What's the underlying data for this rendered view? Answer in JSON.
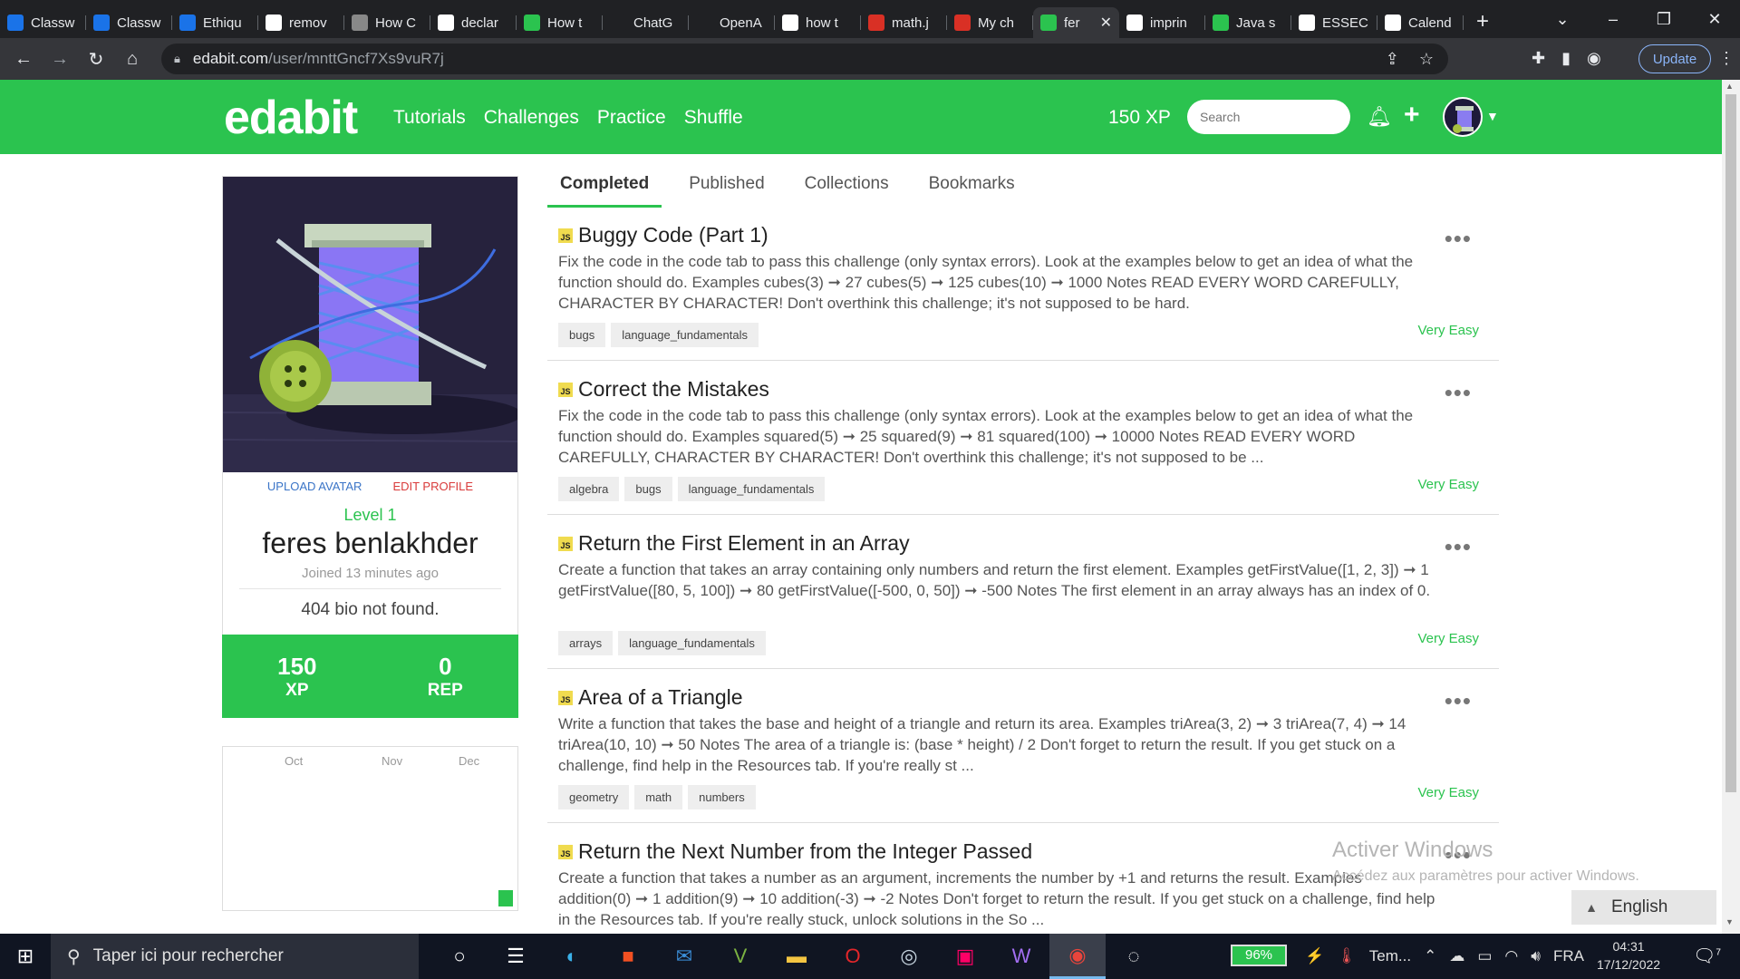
{
  "browser": {
    "tabs": [
      {
        "label": "Classw",
        "icon": "classroom-icon",
        "color": "#1a73e8"
      },
      {
        "label": "Classw",
        "icon": "classroom-icon",
        "color": "#1a73e8"
      },
      {
        "label": "Ethiqu",
        "icon": "classroom-icon",
        "color": "#1a73e8"
      },
      {
        "label": "remov",
        "icon": "google-icon",
        "color": "#ffffff"
      },
      {
        "label": "How C",
        "icon": "triangle-icon",
        "color": "#888888"
      },
      {
        "label": "declar",
        "icon": "google-icon",
        "color": "#ffffff"
      },
      {
        "label": "How t",
        "icon": "wave-icon",
        "color": "#2bc34f"
      },
      {
        "label": "ChatG",
        "icon": "chatgpt-icon",
        "color": "#202124"
      },
      {
        "label": "OpenA",
        "icon": "openai-icon",
        "color": "#202124"
      },
      {
        "label": "how t",
        "icon": "google-icon",
        "color": "#ffffff"
      },
      {
        "label": "math.j",
        "icon": "m-icon",
        "color": "#d93025"
      },
      {
        "label": "My ch",
        "icon": "opera-icon",
        "color": "#d93025"
      },
      {
        "label": "fer",
        "icon": "edabit-icon",
        "color": "#2bc34f",
        "active": true
      },
      {
        "label": "imprin",
        "icon": "google-icon",
        "color": "#ffffff"
      },
      {
        "label": "Java s",
        "icon": "w-icon",
        "color": "#2bc34f"
      },
      {
        "label": "ESSEC",
        "icon": "essec-icon",
        "color": "#ffffff"
      },
      {
        "label": "Calend",
        "icon": "calendar-icon",
        "color": "#ffffff"
      }
    ],
    "url_host": "edabit.com",
    "url_path": "/user/mnttGncf7Xs9vuR7j",
    "update_label": "Update"
  },
  "site": {
    "logo": "edabit",
    "nav": [
      "Tutorials",
      "Challenges",
      "Practice",
      "Shuffle"
    ],
    "xp": "150 XP",
    "search_placeholder": "Search"
  },
  "profile": {
    "upload_avatar": "UPLOAD AVATAR",
    "edit_profile": "EDIT PROFILE",
    "level": "Level 1",
    "username": "feres benlakhder",
    "joined": "Joined 13 minutes ago",
    "bio": "404 bio not found.",
    "xp_value": "150",
    "xp_label": "XP",
    "rep_value": "0",
    "rep_label": "REP"
  },
  "heatmap": {
    "months": [
      "Oct",
      "Nov",
      "Dec"
    ]
  },
  "tabs": [
    "Completed",
    "Published",
    "Collections",
    "Bookmarks"
  ],
  "challenges": [
    {
      "lang": "JS",
      "title": "Buggy Code (Part 1)",
      "desc": "Fix the code in the code tab to pass this challenge (only syntax errors). Look at the examples below to get an idea of what the function should do. Examples cubes(3) ➞ 27 cubes(5) ➞ 125 cubes(10) ➞ 1000 Notes READ EVERY WORD CAREFULLY, CHARACTER BY CHARACTER! Don't overthink this challenge; it's not supposed to be hard.",
      "tags": [
        "bugs",
        "language_fundamentals"
      ],
      "difficulty": "Very Easy"
    },
    {
      "lang": "JS",
      "title": "Correct the Mistakes",
      "desc": "Fix the code in the code tab to pass this challenge (only syntax errors). Look at the examples below to get an idea of what the function should do. Examples squared(5) ➞ 25 squared(9) ➞ 81 squared(100) ➞ 10000 Notes READ EVERY WORD CAREFULLY, CHARACTER BY CHARACTER! Don't overthink this challenge; it's not supposed to be ...",
      "tags": [
        "algebra",
        "bugs",
        "language_fundamentals"
      ],
      "difficulty": "Very Easy"
    },
    {
      "lang": "JS",
      "title": "Return the First Element in an Array",
      "desc": "Create a function that takes an array containing only numbers and return the first element. Examples getFirstValue([1, 2, 3]) ➞ 1 getFirstValue([80, 5, 100]) ➞ 80 getFirstValue([-500, 0, 50]) ➞ -500 Notes The first element in an array always has an index of 0.",
      "tags": [
        "arrays",
        "language_fundamentals"
      ],
      "difficulty": "Very Easy"
    },
    {
      "lang": "JS",
      "title": "Area of a Triangle",
      "desc": "Write a function that takes the base and height of a triangle and return its area. Examples triArea(3, 2) ➞ 3 triArea(7, 4) ➞ 14 triArea(10, 10) ➞ 50 Notes The area of a triangle is: (base * height) / 2 Don't forget to return the result. If you get stuck on a challenge, find help in the Resources tab. If you're really st ...",
      "tags": [
        "geometry",
        "math",
        "numbers"
      ],
      "difficulty": "Very Easy"
    },
    {
      "lang": "JS",
      "title": "Return the Next Number from the Integer Passed",
      "desc": "Create a function that takes a number as an argument, increments the number by +1 and returns the result. Examples addition(0) ➞ 1 addition(9) ➞ 10 addition(-3) ➞ -2 Notes Don't forget to return the result. If you get stuck on a challenge, find help in the Resources tab. If you're really stuck, unlock solutions in the So ...",
      "tags": [],
      "difficulty": ""
    }
  ],
  "watermark": {
    "line1": "Activer Windows",
    "line2": "Accédez aux paramètres pour activer Windows."
  },
  "language_button": "English",
  "taskbar": {
    "search_placeholder": "Taper ici pour rechercher",
    "battery": "96%",
    "weather": "Tem...",
    "lang": "FRA",
    "time": "04:31",
    "date": "17/12/2022",
    "notif_count": "7"
  }
}
